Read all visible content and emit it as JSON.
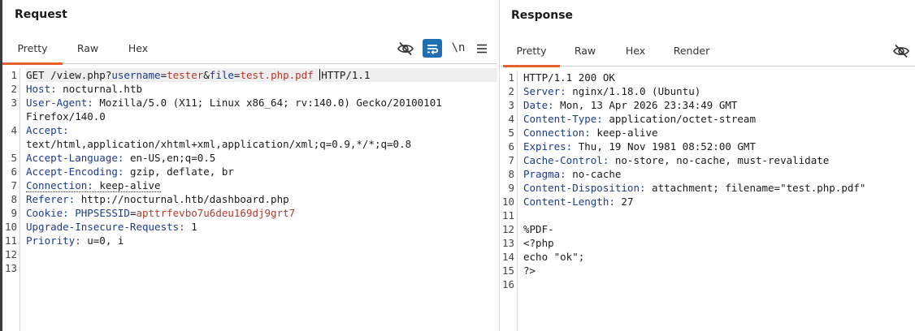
{
  "request": {
    "title": "Request",
    "tabs": [
      "Pretty",
      "Raw",
      "Hex"
    ],
    "active_tab": "Pretty",
    "toolbar": {
      "hide_icon": "eye-slash-icon",
      "wrap_icon": "word-wrap-icon",
      "newline_label": "\\n",
      "menu_icon": "hamburger-menu-icon"
    },
    "line_numbers": [
      "1",
      "2",
      "3",
      "4",
      "5",
      "6",
      "7",
      "8",
      "9",
      "10",
      "11",
      "12",
      "13"
    ],
    "lines": {
      "l1": {
        "method_path": "GET /view.php?",
        "p1_name": "username",
        "eq1": "=",
        "p1_val": "tester",
        "amp": "&",
        "p2_name": "file",
        "eq2": "=",
        "p2_val": "test.php.pdf",
        "space": " ",
        "proto": "HTTP/1.1"
      },
      "l2": {
        "name": "Host:",
        "value": " nocturnal.htb"
      },
      "l3a": {
        "name": "User-Agent:",
        "value": " Mozilla/5.0 (X11; Linux x86_64; rv:140.0) Gecko/20100101"
      },
      "l3b": {
        "value": "Firefox/140.0"
      },
      "l4a": {
        "name": "Accept:"
      },
      "l4b": {
        "value": "text/html,application/xhtml+xml,application/xml;q=0.9,*/*;q=0.8"
      },
      "l5": {
        "name": "Accept-Language:",
        "value": " en-US,en;q=0.5"
      },
      "l6": {
        "name": "Accept-Encoding:",
        "value": " gzip, deflate, br"
      },
      "l7": {
        "name": "Connection:",
        "value": " keep-alive"
      },
      "l8": {
        "name": "Referer:",
        "value": " http://nocturnal.htb/dashboard.php"
      },
      "l9": {
        "name": "Cookie:",
        "sp": " ",
        "c_name": "PHPSESSID",
        "eq": "=",
        "c_val": "apttrfevbo7u6deu169dj9grt7"
      },
      "l10": {
        "name": "Upgrade-Insecure-Requests:",
        "value": " 1"
      },
      "l11": {
        "name": "Priority:",
        "value": " u=0, i"
      }
    }
  },
  "response": {
    "title": "Response",
    "tabs": [
      "Pretty",
      "Raw",
      "Hex",
      "Render"
    ],
    "active_tab": "Pretty",
    "toolbar": {
      "hide_icon": "eye-slash-icon"
    },
    "line_numbers": [
      "1",
      "2",
      "3",
      "4",
      "5",
      "6",
      "7",
      "8",
      "9",
      "10",
      "11",
      "12",
      "13",
      "14",
      "15",
      "16"
    ],
    "lines": {
      "l1": {
        "value": "HTTP/1.1 200 OK"
      },
      "l2": {
        "name": "Server:",
        "value": " nginx/1.18.0 (Ubuntu)"
      },
      "l3": {
        "name": "Date:",
        "value": " Mon, 13 Apr 2026 23:34:49 GMT"
      },
      "l4": {
        "name": "Content-Type:",
        "value": " application/octet-stream"
      },
      "l5": {
        "name": "Connection:",
        "value": " keep-alive"
      },
      "l6": {
        "name": "Expires:",
        "value": " Thu, 19 Nov 1981 08:52:00 GMT"
      },
      "l7": {
        "name": "Cache-Control:",
        "value": " no-store, no-cache, must-revalidate"
      },
      "l8": {
        "name": "Pragma:",
        "value": " no-cache"
      },
      "l9": {
        "name": "Content-Disposition:",
        "value": " attachment; filename=\"test.php.pdf\""
      },
      "l10": {
        "name": "Content-Length:",
        "value": " 27"
      },
      "l11": {
        "value": ""
      },
      "l12": {
        "value": "%PDF-"
      },
      "l13": {
        "value": "<?php"
      },
      "l14": {
        "value": "echo \"ok\";"
      },
      "l15": {
        "value": "?>"
      },
      "l16": {
        "value": ""
      }
    }
  },
  "colors": {
    "accent_tab": "#e8622f",
    "header_name": "#1d3b8c",
    "param_value": "#b03a2e",
    "wrap_button_bg": "#1f6fb2"
  }
}
